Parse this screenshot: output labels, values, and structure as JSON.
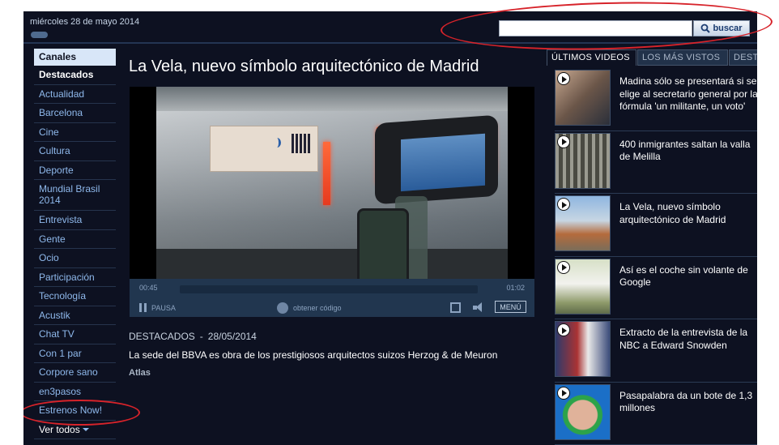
{
  "header": {
    "date": "miércoles 28 de mayo 2014",
    "search": {
      "placeholder": "",
      "button_label": "buscar"
    }
  },
  "sidebar": {
    "header": "Canales",
    "items": [
      {
        "label": "Destacados",
        "style": "bold"
      },
      {
        "label": "Actualidad"
      },
      {
        "label": "Barcelona"
      },
      {
        "label": "Cine"
      },
      {
        "label": "Cultura"
      },
      {
        "label": "Deporte"
      },
      {
        "label": "Mundial Brasil 2014"
      },
      {
        "label": "Entrevista"
      },
      {
        "label": "Gente"
      },
      {
        "label": "Ocio"
      },
      {
        "label": "Participación"
      },
      {
        "label": "Tecnología"
      },
      {
        "label": "Acustik"
      },
      {
        "label": "Chat TV"
      },
      {
        "label": "Con 1 par"
      },
      {
        "label": "Corpore sano"
      },
      {
        "label": "en3pasos"
      },
      {
        "label": "Estrenos Now!"
      },
      {
        "label": "Ver todos",
        "style": "white"
      }
    ]
  },
  "main": {
    "title": "La Vela, nuevo símbolo arquitectónico de Madrid",
    "player": {
      "time_current": "00:45",
      "time_total": "01:02",
      "progress": 0.0,
      "pause_label": "PAUSA",
      "code_label": "obtener código",
      "menu_label": "MENÚ"
    },
    "category": "DESTACADOS",
    "separator": "-",
    "date": "28/05/2014",
    "description": "La sede del BBVA es obra de los prestigiosos arquitectos suizos Herzog & de Meuron",
    "author": "Atlas"
  },
  "right_panel": {
    "tabs": [
      "ÚLTIMOS VIDEOS",
      "LOS MÁS VISTOS",
      "DEST"
    ],
    "videos": [
      {
        "title": "Madina sólo se presentará si se elige al secretario general por la fórmula 'un militante, un voto'"
      },
      {
        "title": "400 inmigrantes saltan la valla de Melilla"
      },
      {
        "title": "La Vela, nuevo símbolo arquitectónico de Madrid"
      },
      {
        "title": "Así es el coche sin volante de Google"
      },
      {
        "title": "Extracto de la entrevista de la NBC a Edward Snowden"
      },
      {
        "title": "Pasapalabra da un bote de 1,3 millones"
      }
    ]
  },
  "colors": {
    "background": "#0d1121",
    "link": "#8fb9ec",
    "annotation": "#d7232a"
  }
}
